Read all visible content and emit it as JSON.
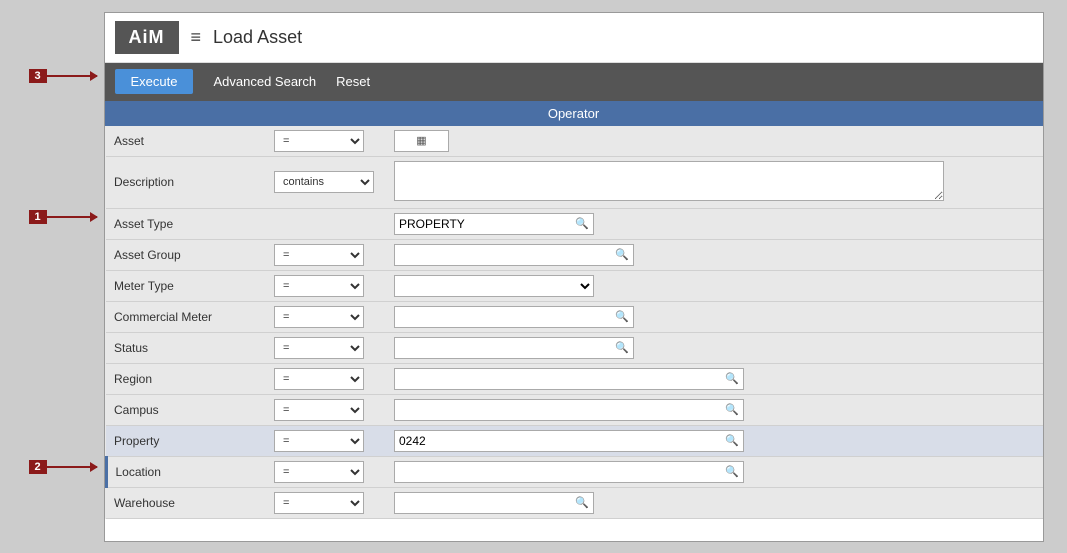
{
  "app": {
    "logo": "AiM",
    "hamburger": "≡",
    "page_title": "Load Asset"
  },
  "toolbar": {
    "execute_label": "Execute",
    "advanced_search_label": "Advanced Search",
    "reset_label": "Reset"
  },
  "steps": {
    "step1": {
      "label": "1"
    },
    "step2": {
      "label": "2"
    },
    "step3": {
      "label": "3"
    }
  },
  "section": {
    "operator_label": "Operator"
  },
  "form": {
    "fields": [
      {
        "label": "Asset",
        "operator": "=",
        "value": "",
        "type": "input-icon",
        "icon": "📋"
      },
      {
        "label": "Description",
        "operator": "contains",
        "value": "",
        "type": "textarea"
      },
      {
        "label": "Asset Type",
        "operator": "",
        "value": "PROPERTY",
        "type": "search-plain"
      },
      {
        "label": "Asset Group",
        "operator": "=",
        "value": "",
        "type": "search"
      },
      {
        "label": "Meter Type",
        "operator": "=",
        "value": "",
        "type": "dropdown"
      },
      {
        "label": "Commercial Meter",
        "operator": "=",
        "value": "",
        "type": "search"
      },
      {
        "label": "Status",
        "operator": "=",
        "value": "",
        "type": "search"
      },
      {
        "label": "Region",
        "operator": "=",
        "value": "",
        "type": "search"
      },
      {
        "label": "Campus",
        "operator": "=",
        "value": "",
        "type": "search"
      },
      {
        "label": "Property",
        "operator": "=",
        "value": "0242",
        "type": "search"
      },
      {
        "label": "Location",
        "operator": "=",
        "value": "",
        "type": "search"
      },
      {
        "label": "Warehouse",
        "operator": "=",
        "value": "",
        "type": "search"
      }
    ]
  }
}
